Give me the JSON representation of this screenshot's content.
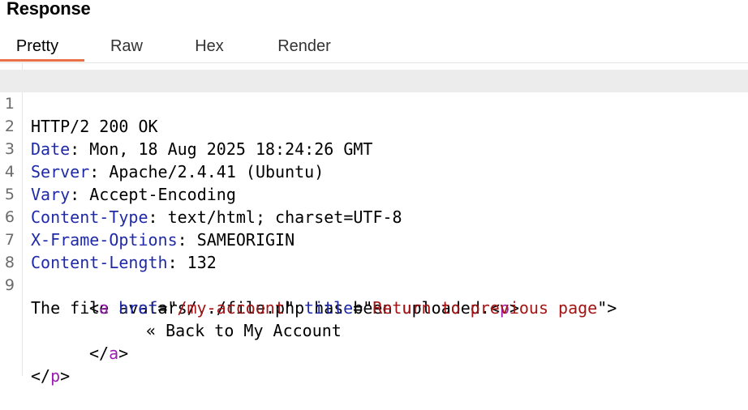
{
  "panel": {
    "title": "Response"
  },
  "tabs": [
    {
      "label": "Pretty",
      "active": true
    },
    {
      "label": "Raw",
      "active": false
    },
    {
      "label": "Hex",
      "active": false
    },
    {
      "label": "Render",
      "active": false
    }
  ],
  "colors": {
    "accent_underline": "#e8714a",
    "header_name": "#1f2aa8",
    "html_tag": "#9a1fb0",
    "html_attr": "#1f2aa8",
    "html_string": "#a31515",
    "current_line_bg": "#ececec"
  },
  "response": {
    "status_line": "HTTP/2 200 OK",
    "headers": [
      {
        "name": "Date",
        "value": "Mon, 18 Aug 2025 18:24:26 GMT"
      },
      {
        "name": "Server",
        "value": "Apache/2.4.41 (Ubuntu)"
      },
      {
        "name": "Vary",
        "value": "Accept-Encoding"
      },
      {
        "name": "Content-Type",
        "value": "text/html; charset=UTF-8"
      },
      {
        "name": "X-Frame-Options",
        "value": "SAMEORIGIN"
      },
      {
        "name": "Content-Length",
        "value": "132"
      }
    ],
    "body": {
      "text": "The file avatars/../file.php has been uploaded.",
      "p_tag": "p",
      "a_tag": "a",
      "href_attr": "href",
      "href_value": "/my-account",
      "title_attr": "title",
      "title_value": "Return to previous page",
      "link_text": "« Back to My Account"
    }
  },
  "line_numbers": [
    "1",
    "2",
    "3",
    "4",
    "5",
    "6",
    "7",
    "8",
    "9"
  ]
}
